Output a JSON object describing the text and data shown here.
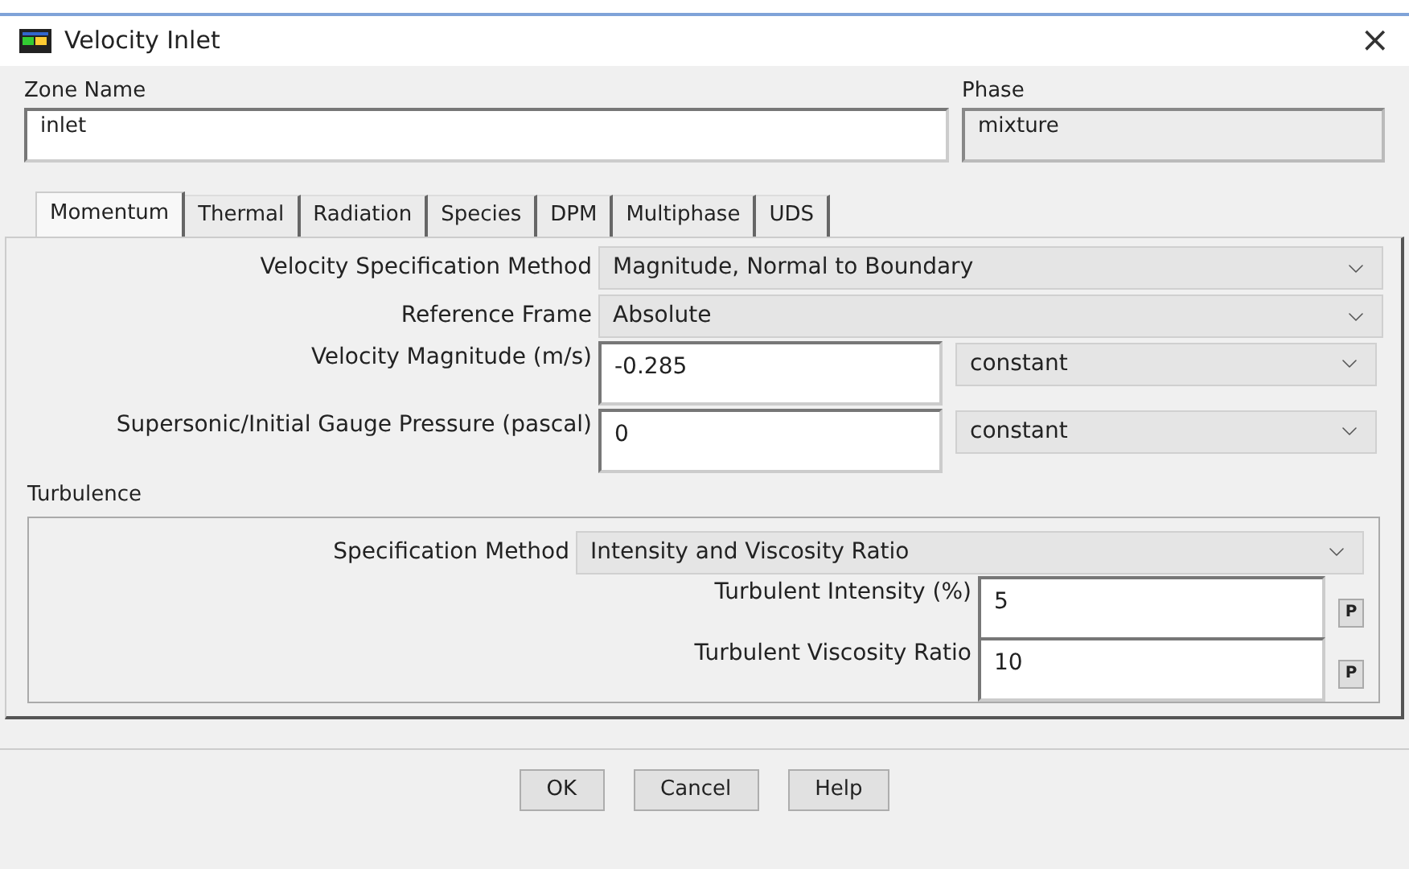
{
  "window": {
    "title": "Velocity Inlet",
    "close": "×"
  },
  "zone_name": {
    "label": "Zone Name",
    "value": "inlet"
  },
  "phase": {
    "label": "Phase",
    "value": "mixture"
  },
  "tabs": [
    {
      "label": "Momentum",
      "selected": true
    },
    {
      "label": "Thermal",
      "selected": false
    },
    {
      "label": "Radiation",
      "selected": false
    },
    {
      "label": "Species",
      "selected": false
    },
    {
      "label": "DPM",
      "selected": false
    },
    {
      "label": "Multiphase",
      "selected": false
    },
    {
      "label": "UDS",
      "selected": false
    }
  ],
  "momentum_rows": [
    {
      "kind": "dropdown",
      "label": "Velocity Specification Method",
      "value": "Magnitude, Normal to Boundary"
    },
    {
      "kind": "dropdown",
      "label": "Reference Frame",
      "value": "Absolute"
    },
    {
      "kind": "input",
      "label": "Velocity Magnitude (m/s)",
      "value": "-0.285",
      "method": "constant"
    },
    {
      "kind": "input",
      "label": "Supersonic/Initial Gauge Pressure (pascal)",
      "value": "0",
      "method": "constant"
    }
  ],
  "turbulence": {
    "label": "Turbulence",
    "rows": [
      {
        "kind": "dropdown",
        "label": "Specification Method",
        "value": "Intensity and Viscosity Ratio"
      },
      {
        "kind": "param",
        "label": "Turbulent Intensity (%)",
        "value": "5",
        "button": "P"
      },
      {
        "kind": "param",
        "label": "Turbulent Viscosity Ratio",
        "value": "10",
        "button": "P"
      }
    ]
  },
  "buttons": [
    "OK",
    "Cancel",
    "Help"
  ]
}
